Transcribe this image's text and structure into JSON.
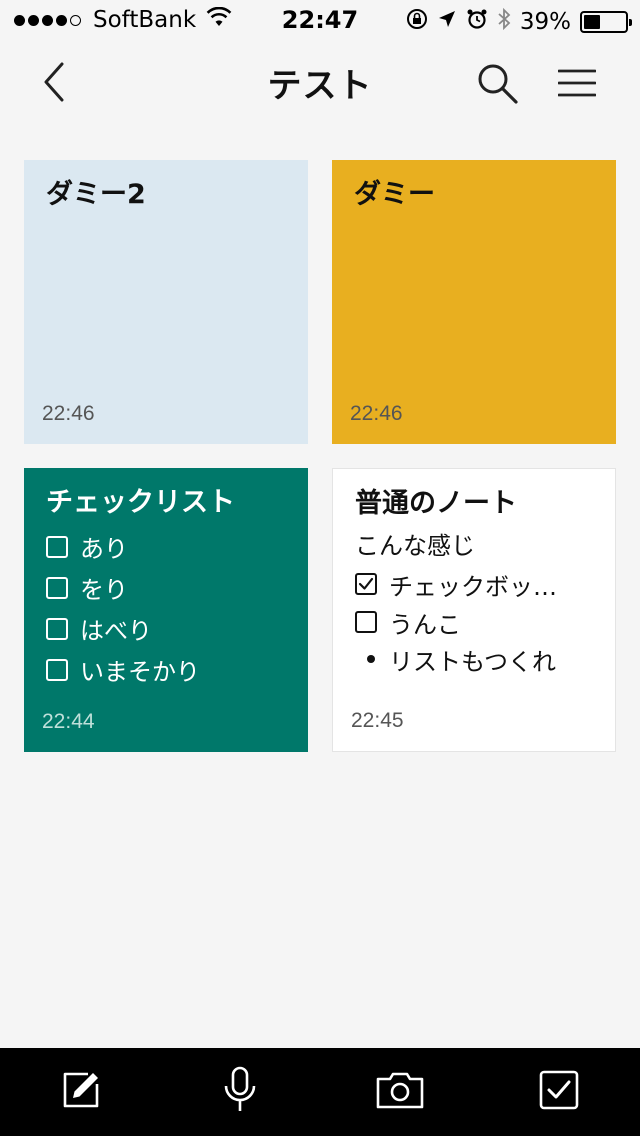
{
  "status_bar": {
    "carrier": "SoftBank",
    "time": "22:47",
    "battery_percent": "39%",
    "battery_level": 0.39,
    "signal_bars_filled": 4,
    "signal_bars_total": 5,
    "icons": [
      "wifi-icon",
      "orientation-lock-icon",
      "location-arrow-icon",
      "alarm-icon",
      "bluetooth-icon",
      "battery-icon"
    ]
  },
  "nav": {
    "title": "テスト",
    "icons": [
      "chevron-left-icon",
      "search-icon",
      "menu-icon"
    ]
  },
  "notes": [
    {
      "title": "ダミー2",
      "time": "22:46",
      "color": "#dbe8f1"
    },
    {
      "title": "ダミー",
      "time": "22:46",
      "color": "#e8af20"
    },
    {
      "title": "チェックリスト",
      "time": "22:44",
      "color": "#00786a",
      "checklist": [
        {
          "label": "あり",
          "checked": false
        },
        {
          "label": "をり",
          "checked": false
        },
        {
          "label": "はべり",
          "checked": false
        },
        {
          "label": "いまそかり",
          "checked": false
        }
      ]
    },
    {
      "title": "普通のノート",
      "time": "22:45",
      "color": "#ffffff",
      "body_text": "こんな感じ",
      "checklist": [
        {
          "label": "チェックボッ…",
          "checked": true
        },
        {
          "label": "うんこ",
          "checked": false
        }
      ],
      "bullets": [
        "リストもつくれ"
      ]
    }
  ],
  "toolbar": {
    "background": "#000000",
    "icons": [
      "pencil-note-icon",
      "microphone-icon",
      "camera-icon",
      "checkbox-icon"
    ]
  }
}
